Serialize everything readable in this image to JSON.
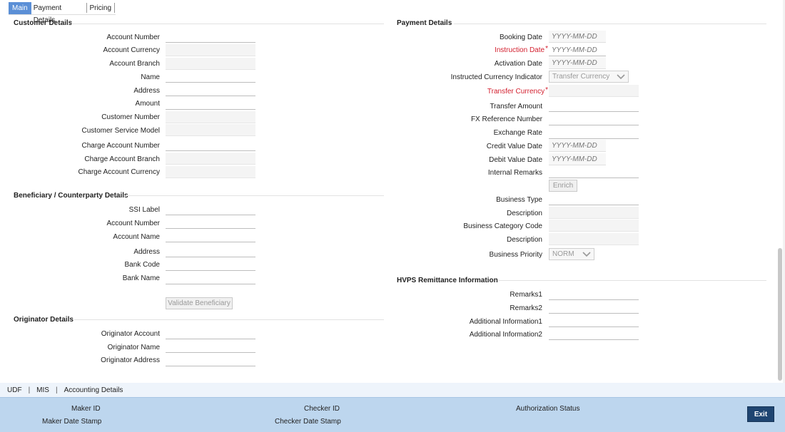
{
  "tabs": [
    "Main",
    "Payment Details",
    "Pricing"
  ],
  "customer": {
    "title": "Customer Details",
    "fields": [
      {
        "label": "Account Number",
        "value": ""
      },
      {
        "label": "Account Currency",
        "value": ""
      },
      {
        "label": "Account Branch",
        "value": ""
      },
      {
        "label": "Name",
        "value": ""
      },
      {
        "label": "Address",
        "value": ""
      },
      {
        "label": "Amount",
        "value": ""
      },
      {
        "label": "Customer Number",
        "value": ""
      },
      {
        "label": "Customer Service Model",
        "value": ""
      },
      {
        "label": "Charge Account Number",
        "value": ""
      },
      {
        "label": "Charge Account Branch",
        "value": ""
      },
      {
        "label": "Charge Account Currency",
        "value": ""
      }
    ]
  },
  "beneficiary": {
    "title": "Beneficiary / Counterparty Details",
    "fields": [
      {
        "label": "SSI Label",
        "value": ""
      },
      {
        "label": "Account Number",
        "value": ""
      },
      {
        "label": "Account Name",
        "value": ""
      },
      {
        "label": "Address",
        "value": ""
      },
      {
        "label": "Bank Code",
        "value": ""
      },
      {
        "label": "Bank Name",
        "value": ""
      }
    ],
    "validate_label": "Validate Beneficiary"
  },
  "originator": {
    "title": "Originator Details",
    "fields": [
      {
        "label": "Originator Account",
        "value": ""
      },
      {
        "label": "Originator Name",
        "value": ""
      },
      {
        "label": "Originator Address",
        "value": ""
      }
    ]
  },
  "payment": {
    "title": "Payment Details",
    "date_placeholder": "YYYY-MM-DD",
    "booking_date": "Booking Date",
    "instruction_date": "Instruction Date",
    "activation_date": "Activation Date",
    "instructed_currency_indicator": "Instructed Currency Indicator",
    "instructed_currency_value": "Transfer Currency",
    "transfer_currency": "Transfer Currency",
    "transfer_amount": "Transfer Amount",
    "fx_reference_number": "FX Reference Number",
    "exchange_rate": "Exchange Rate",
    "credit_value_date": "Credit Value Date",
    "debit_value_date": "Debit Value Date",
    "internal_remarks": "Internal Remarks",
    "enrich_label": "Enrich",
    "business_type": "Business Type",
    "description1": "Description",
    "business_category_code": "Business Category Code",
    "description2": "Description",
    "business_priority": "Business Priority",
    "business_priority_value": "NORM",
    "required_mark": "*"
  },
  "hvps": {
    "title": "HVPS Remittance Information",
    "fields": [
      {
        "label": "Remarks1",
        "value": ""
      },
      {
        "label": "Remarks2",
        "value": ""
      },
      {
        "label": "Additional Information1",
        "value": ""
      },
      {
        "label": "Additional Information2",
        "value": ""
      }
    ]
  },
  "subnav": [
    "UDF",
    "MIS",
    "Accounting Details"
  ],
  "subnav_sep": "|",
  "footer": {
    "maker_id": "Maker ID",
    "maker_date_stamp": "Maker Date Stamp",
    "checker_id": "Checker ID",
    "checker_date_stamp": "Checker Date Stamp",
    "authorization_status": "Authorization Status",
    "exit_label": "Exit"
  }
}
